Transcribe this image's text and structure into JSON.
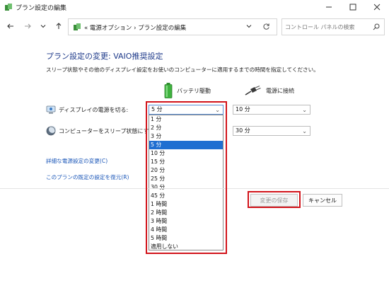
{
  "window": {
    "title": "プラン設定の編集"
  },
  "address": {
    "crumbs": "«  電源オプション  ›  プラン設定の編集",
    "search_placeholder": "コントロール パネルの検索"
  },
  "main": {
    "heading": "プラン設定の変更: VAIO推奨設定",
    "description": "スリープ状態やその他のディスプレイ設定をお使いのコンピューターに適用するまでの時間を指定してください。",
    "columns": {
      "battery": "バッテリ駆動",
      "ac": "電源に接続"
    },
    "rows": [
      {
        "label": "ディスプレイの電源を切る:",
        "battery_value": "5 分",
        "ac_value": "10 分"
      },
      {
        "label": "コンピューターをスリープ状態にする:",
        "ac_value": "30 分"
      }
    ],
    "dropdown_options": [
      "1 分",
      "2 分",
      "3 分",
      "5 分",
      "10 分",
      "15 分",
      "20 分",
      "25 分",
      "30 分",
      "45 分",
      "1 時間",
      "2 時間",
      "3 時間",
      "4 時間",
      "5 時間",
      "適用しない"
    ],
    "dropdown_selected_index": 3,
    "links": {
      "advanced": "詳細な電源設定の変更(C)",
      "restore": "このプランの既定の設定を復元(R)"
    },
    "buttons": {
      "save": "変更の保存",
      "cancel": "キャンセル"
    }
  },
  "colors": {
    "highlight": "#d2141b",
    "heading": "#1e3a8a",
    "link": "#1a56b8",
    "selection": "#1f6fd1"
  }
}
